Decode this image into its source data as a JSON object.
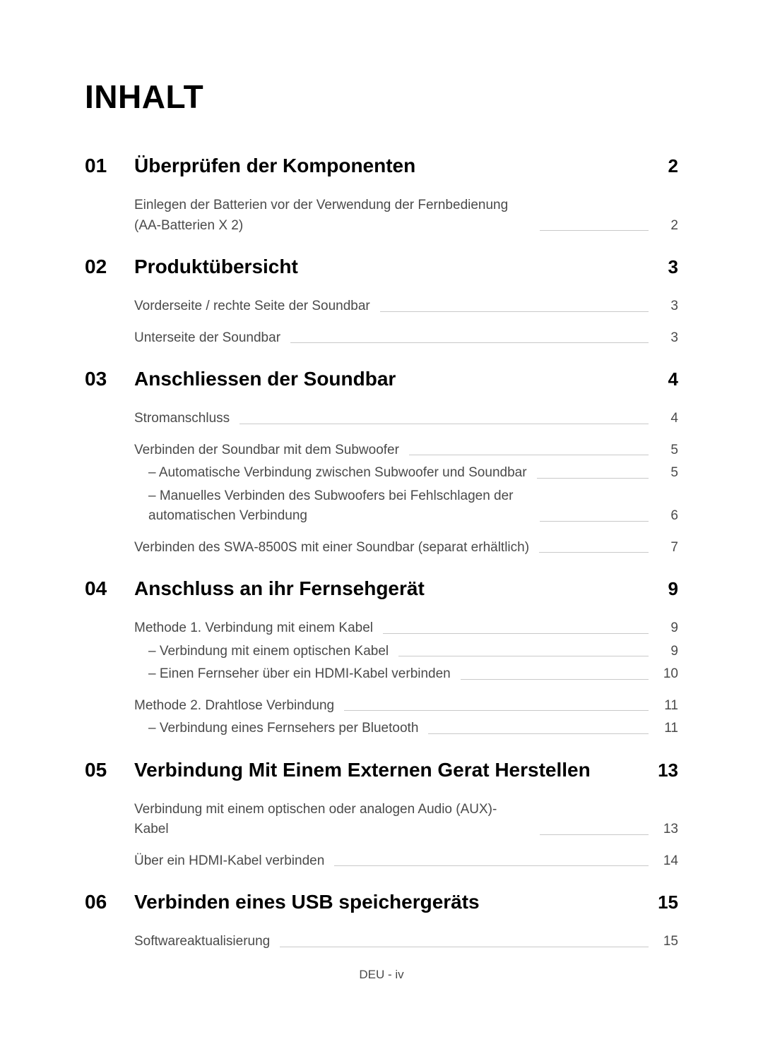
{
  "title": "INHALT",
  "footer": "DEU - iv",
  "sections": [
    {
      "num": "01",
      "title": "Überprüfen der Komponenten",
      "page": "2",
      "groups": [
        {
          "entries": [
            {
              "text": "Einlegen der Batterien vor der Verwendung der Fernbedienung (AA-Batterien X 2)",
              "page": "2",
              "sub": false
            }
          ]
        }
      ]
    },
    {
      "num": "02",
      "title": "Produktübersicht",
      "page": "3",
      "groups": [
        {
          "entries": [
            {
              "text": "Vorderseite / rechte Seite der Soundbar",
              "page": "3",
              "sub": false
            }
          ]
        },
        {
          "entries": [
            {
              "text": "Unterseite der Soundbar",
              "page": "3",
              "sub": false
            }
          ]
        }
      ]
    },
    {
      "num": "03",
      "title": "Anschliessen der Soundbar",
      "page": "4",
      "groups": [
        {
          "entries": [
            {
              "text": "Stromanschluss",
              "page": "4",
              "sub": false
            }
          ]
        },
        {
          "entries": [
            {
              "text": "Verbinden der Soundbar mit dem Subwoofer",
              "page": "5",
              "sub": false
            },
            {
              "text": "Automatische Verbindung zwischen Subwoofer und Soundbar",
              "page": "5",
              "sub": true
            },
            {
              "text": "Manuelles Verbinden des Subwoofers bei Fehlschlagen der automatischen Verbindung",
              "page": "6",
              "sub": true
            }
          ]
        },
        {
          "entries": [
            {
              "text": "Verbinden des SWA-8500S mit einer Soundbar (separat erhältlich)",
              "page": "7",
              "sub": false
            }
          ]
        }
      ]
    },
    {
      "num": "04",
      "title": "Anschluss an ihr Fernsehgerät",
      "page": "9",
      "groups": [
        {
          "entries": [
            {
              "text": "Methode 1. Verbindung mit einem Kabel",
              "page": "9",
              "sub": false
            },
            {
              "text": "Verbindung mit einem optischen Kabel",
              "page": "9",
              "sub": true
            },
            {
              "text": "Einen Fernseher über ein HDMI-Kabel verbinden",
              "page": "10",
              "sub": true
            }
          ]
        },
        {
          "entries": [
            {
              "text": "Methode 2. Drahtlose Verbindung",
              "page": "11",
              "sub": false
            },
            {
              "text": "Verbindung eines Fernsehers per Bluetooth",
              "page": "11",
              "sub": true
            }
          ]
        }
      ]
    },
    {
      "num": "05",
      "title": "Verbindung Mit Einem Externen Gerat Herstellen",
      "page": "13",
      "groups": [
        {
          "entries": [
            {
              "text": "Verbindung mit einem optischen oder analogen Audio (AUX)-Kabel",
              "page": "13",
              "sub": false
            }
          ]
        },
        {
          "entries": [
            {
              "text": "Über ein HDMI-Kabel verbinden",
              "page": "14",
              "sub": false
            }
          ]
        }
      ]
    },
    {
      "num": "06",
      "title": "Verbinden eines USB speichergeräts",
      "page": "15",
      "groups": [
        {
          "entries": [
            {
              "text": "Softwareaktualisierung",
              "page": "15",
              "sub": false
            }
          ]
        }
      ]
    }
  ]
}
